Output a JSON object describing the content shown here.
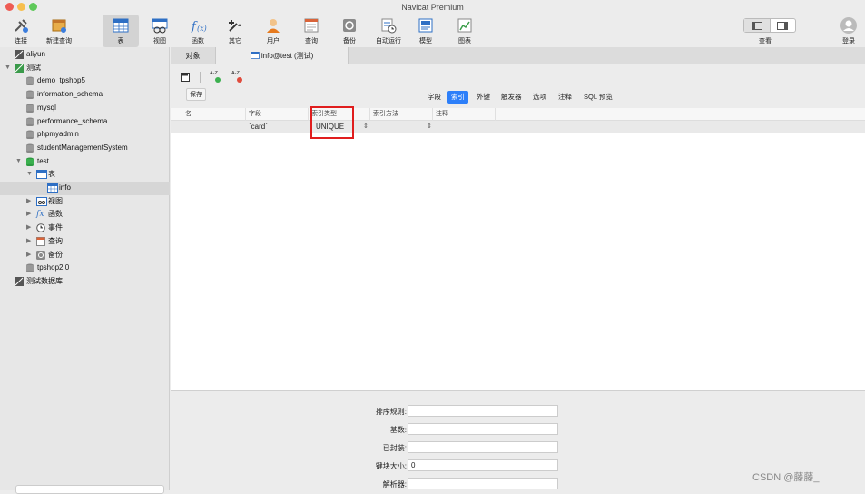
{
  "window": {
    "title": "Navicat Premium"
  },
  "toolbar": {
    "items": [
      {
        "label": "连接",
        "icon": "connection-icon"
      },
      {
        "label": "新建查询",
        "icon": "new-query-icon"
      },
      {
        "label": "表",
        "icon": "table-icon",
        "active": true
      },
      {
        "label": "视图",
        "icon": "view-icon"
      },
      {
        "label": "函数",
        "icon": "function-icon"
      },
      {
        "label": "其它",
        "icon": "other-icon"
      },
      {
        "label": "用户",
        "icon": "user-icon"
      },
      {
        "label": "查询",
        "icon": "query-icon"
      },
      {
        "label": "备份",
        "icon": "backup-icon"
      },
      {
        "label": "自动运行",
        "icon": "automation-icon"
      },
      {
        "label": "模型",
        "icon": "model-icon"
      },
      {
        "label": "图表",
        "icon": "chart-icon"
      }
    ],
    "view_label": "查看",
    "login_label": "登录"
  },
  "sidebar": {
    "items": [
      {
        "label": "aliyun"
      },
      {
        "label": "测试"
      },
      {
        "label": "demo_tpshop5"
      },
      {
        "label": "information_schema"
      },
      {
        "label": "mysql"
      },
      {
        "label": "performance_schema"
      },
      {
        "label": "phpmyadmin"
      },
      {
        "label": "studentManagementSystem"
      },
      {
        "label": "test"
      },
      {
        "label": "表"
      },
      {
        "label": "info"
      },
      {
        "label": "视图"
      },
      {
        "label": "函数"
      },
      {
        "label": "事件"
      },
      {
        "label": "查询"
      },
      {
        "label": "备份"
      },
      {
        "label": "tpshop2.0"
      },
      {
        "label": "测试数据库"
      }
    ]
  },
  "tabs": {
    "objects": "对象",
    "active": "info@test (测试)"
  },
  "actions": {
    "sort_az_add": "A-Z",
    "sort_az_remove": "A-Z",
    "tooltip": "保存"
  },
  "subtabs": [
    "字段",
    "索引",
    "外键",
    "触发器",
    "选项",
    "注释",
    "SQL 预览"
  ],
  "grid": {
    "headers": [
      "名",
      "字段",
      "索引类型",
      "索引方法",
      "注释"
    ],
    "row": {
      "name": "",
      "field": "`card`",
      "type": "UNIQUE",
      "method": ""
    }
  },
  "properties": {
    "labels": [
      "排序规则:",
      "基数:",
      "已封装:",
      "键块大小:",
      "解析器:"
    ],
    "values": [
      "",
      "",
      "",
      "0",
      ""
    ]
  },
  "watermark": "CSDN @藤藤_"
}
